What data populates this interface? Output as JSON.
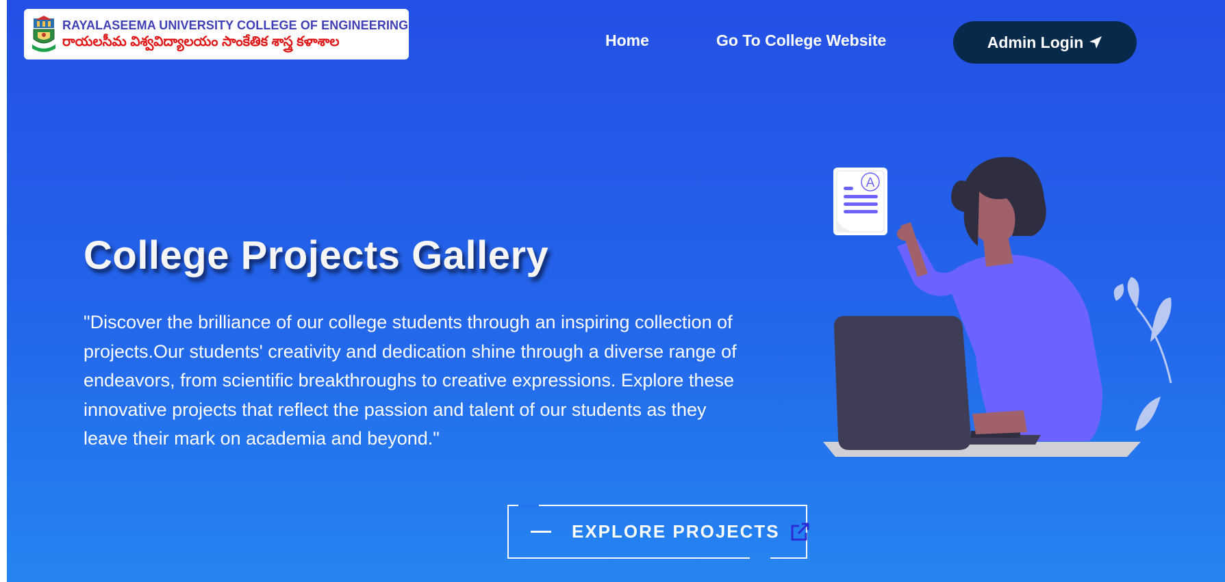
{
  "header": {
    "logo": {
      "name_en": "RAYALASEEMA UNIVERSITY COLLEGE OF ENGINEERING",
      "name_te": "రాయలసీమ విశ్వవిద్యాలయం సాంకేతిక శాస్త్ర కళాశాల",
      "icon": "university-emblem-icon"
    },
    "nav": {
      "home": "Home",
      "college_website": "Go To College Website",
      "admin_login": "Admin Login",
      "admin_icon": "send-arrow-icon"
    }
  },
  "hero": {
    "title": "College Projects Gallery",
    "description": "\"Discover the brilliance of our college students through an inspiring collection of projects.Our students' creativity and dedication shine through a diverse range of endeavors, from scientific breakthroughs to creative expressions. Explore these innovative projects that reflect the passion and talent of our students as they leave their mark on academia and beyond.\"",
    "cta": {
      "label": "EXPLORE PROJECTS",
      "icon": "external-link-icon"
    },
    "illustration": {
      "icon": "student-laptop-illustration",
      "card_letter": "A"
    }
  },
  "colors": {
    "gradient_top": "#2450e5",
    "gradient_bottom": "#2585f2",
    "admin_button": "#072a4a",
    "logo_en_text": "#3f3fb6",
    "logo_te_text": "#e01515",
    "illustration_purple": "#6c63ff"
  }
}
